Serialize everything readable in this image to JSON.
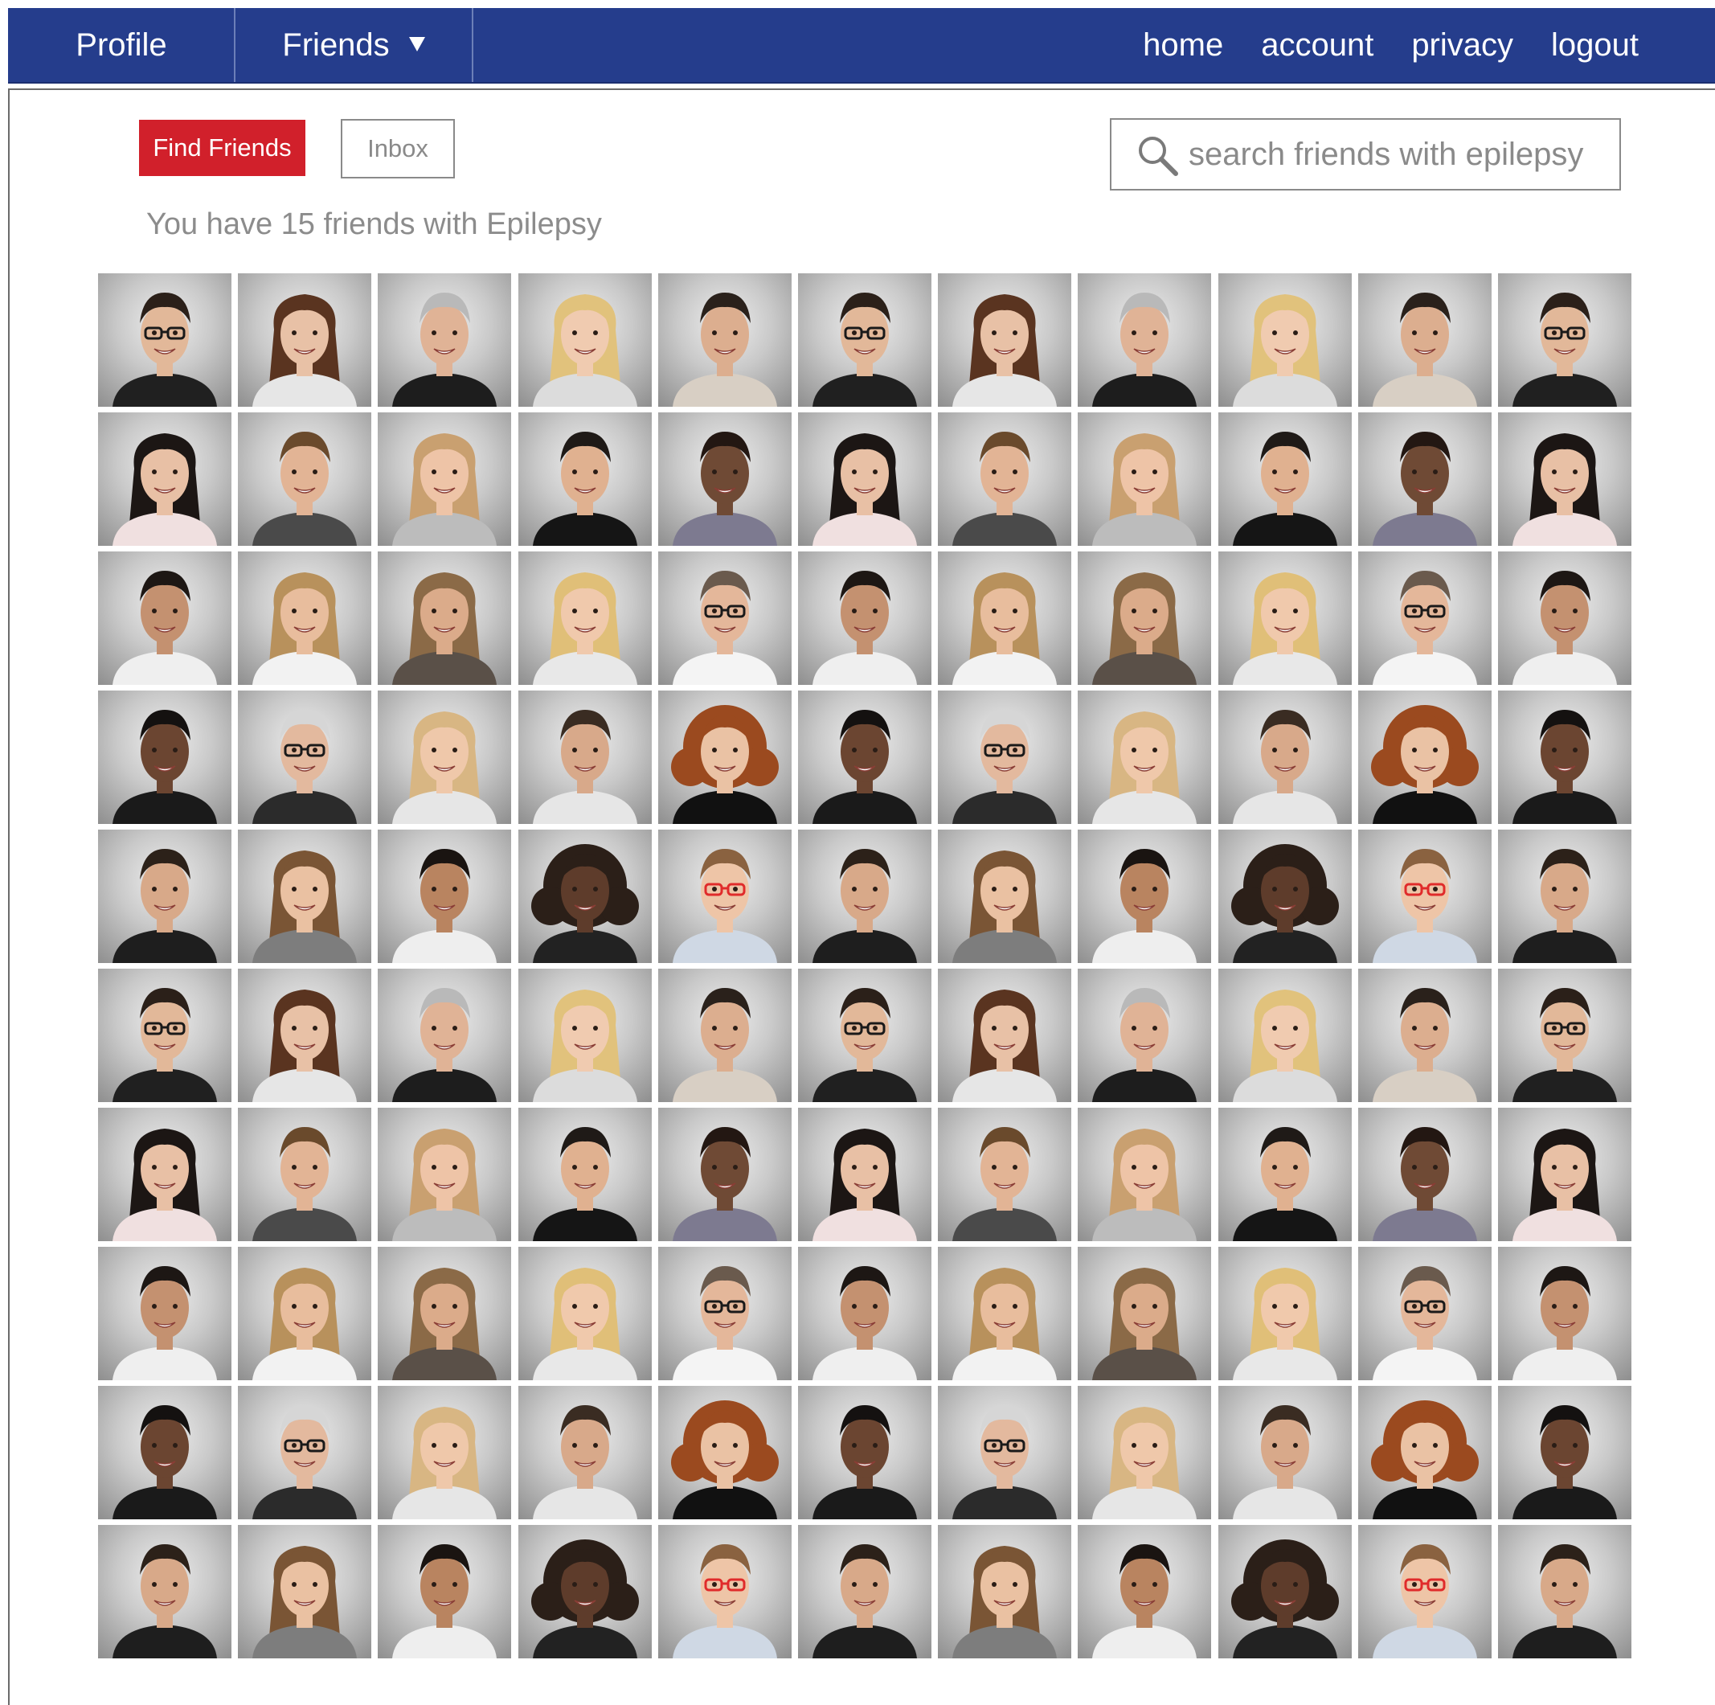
{
  "nav": {
    "tabs": [
      {
        "label": "Profile"
      },
      {
        "label": "Friends"
      }
    ],
    "links": [
      {
        "label": "home"
      },
      {
        "label": "account"
      },
      {
        "label": "privacy"
      },
      {
        "label": "logout"
      }
    ]
  },
  "toolbar": {
    "find_friends_label": "Find Friends",
    "inbox_label": "Inbox"
  },
  "search": {
    "placeholder": "search friends with epilepsy",
    "value": ""
  },
  "summary": {
    "text": "You have 15 friends with Epilepsy"
  },
  "colors": {
    "nav_bg": "#253d8c",
    "accent_red": "#d1202b",
    "muted_text": "#8c8c8c"
  },
  "grid": {
    "columns": 11,
    "rows": 10,
    "row_types": [
      "A",
      "B",
      "C",
      "D",
      "E",
      "A",
      "B",
      "C",
      "D",
      "E"
    ],
    "people_by_row_type": {
      "A": [
        {
          "hair": "#2b2019",
          "skin": "#e2b899",
          "style": "short",
          "shirt": "#202020",
          "glasses": true
        },
        {
          "hair": "#5a3420",
          "skin": "#e8c1a6",
          "style": "long",
          "shirt": "#e6e6e6",
          "glasses": false
        },
        {
          "hair": "#b9b9b9",
          "skin": "#e0b396",
          "style": "short",
          "shirt": "#1d1d1d",
          "glasses": false
        },
        {
          "hair": "#e1c27c",
          "skin": "#f0cbb0",
          "style": "long",
          "shirt": "#dcdcdc",
          "glasses": false
        },
        {
          "hair": "#2a211b",
          "skin": "#dcae8f",
          "style": "short",
          "shirt": "#d8cfc4",
          "glasses": false
        }
      ],
      "B": [
        {
          "hair": "#1c1614",
          "skin": "#e8c0a5",
          "style": "long",
          "shirt": "#f0e0e0",
          "glasses": false
        },
        {
          "hair": "#6a4a2c",
          "skin": "#e2b495",
          "style": "short",
          "shirt": "#4a4a4a",
          "glasses": false
        },
        {
          "hair": "#c9a070",
          "skin": "#eec4a7",
          "style": "long",
          "shirt": "#bcbcbc",
          "glasses": false
        },
        {
          "hair": "#1f1a17",
          "skin": "#e0b190",
          "style": "short",
          "shirt": "#151515",
          "glasses": false
        },
        {
          "hair": "#231712",
          "skin": "#6f4a35",
          "style": "short",
          "shirt": "#7d7a90",
          "glasses": false
        }
      ],
      "C": [
        {
          "hair": "#1d1714",
          "skin": "#c49170",
          "style": "short",
          "shirt": "#efefef",
          "glasses": false
        },
        {
          "hair": "#b8915c",
          "skin": "#e8bd9d",
          "style": "long",
          "shirt": "#f2f2f2",
          "glasses": false
        },
        {
          "hair": "#8b6a47",
          "skin": "#dbab8a",
          "style": "long",
          "shirt": "#5a5048",
          "glasses": false
        },
        {
          "hair": "#e0bf78",
          "skin": "#f0c9ac",
          "style": "long",
          "shirt": "#e8e8e8",
          "glasses": false
        },
        {
          "hair": "#6a5a4d",
          "skin": "#e4b79a",
          "style": "short",
          "shirt": "#f4f4f4",
          "glasses": true
        }
      ],
      "D": [
        {
          "hair": "#141110",
          "skin": "#6b4531",
          "style": "short",
          "shirt": "#1a1a1a",
          "glasses": false
        },
        {
          "hair": "#d6d6d6",
          "skin": "#e3b99e",
          "style": "short",
          "shirt": "#2b2b2b",
          "glasses": true
        },
        {
          "hair": "#d8b683",
          "skin": "#efc8aa",
          "style": "long",
          "shirt": "#e6e6e6",
          "glasses": false
        },
        {
          "hair": "#3a2c22",
          "skin": "#d8a98a",
          "style": "short",
          "shirt": "#e6e6e6",
          "glasses": false
        },
        {
          "hair": "#9b4a1f",
          "skin": "#eac2a4",
          "style": "curly",
          "shirt": "#111111",
          "glasses": false
        }
      ],
      "E": [
        {
          "hair": "#2c2119",
          "skin": "#d8a989",
          "style": "short",
          "shirt": "#1e1e1e",
          "glasses": false
        },
        {
          "hair": "#7a5535",
          "skin": "#eac1a2",
          "style": "long",
          "shirt": "#7d7d7d",
          "glasses": false
        },
        {
          "hair": "#1a1411",
          "skin": "#b98460",
          "style": "short",
          "shirt": "#eeeeee",
          "glasses": false
        },
        {
          "hair": "#2b1f18",
          "skin": "#5e3c2b",
          "style": "curly",
          "shirt": "#222222",
          "glasses": false
        },
        {
          "hair": "#8a6240",
          "skin": "#eec5a7",
          "style": "short",
          "shirt": "#cfd8e4",
          "glasses": true,
          "glasses_color": "#e02b2b"
        }
      ]
    }
  }
}
